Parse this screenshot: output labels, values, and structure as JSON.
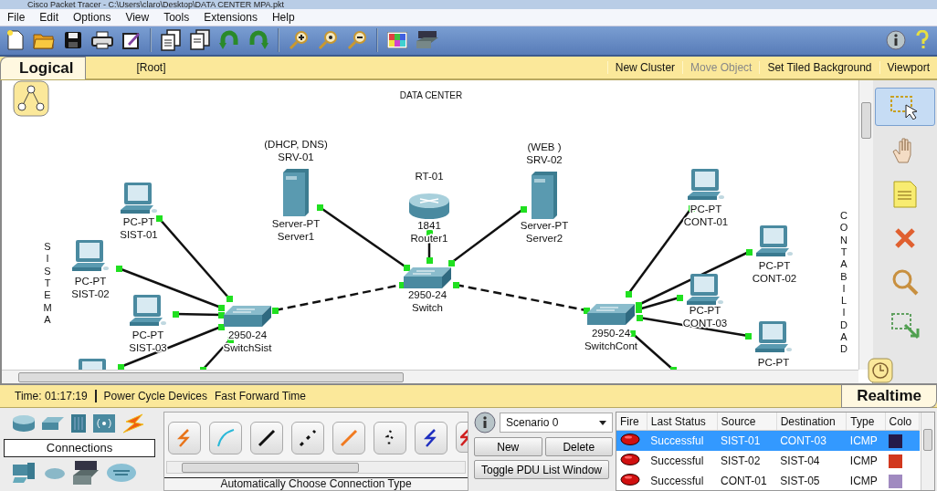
{
  "window": {
    "title": "Cisco Packet Tracer - C:\\Users\\claro\\Desktop\\DATA CENTER MPA.pkt"
  },
  "menu": [
    "File",
    "Edit",
    "Options",
    "View",
    "Tools",
    "Extensions",
    "Help"
  ],
  "workspace_bar": {
    "mode": "Logical",
    "path": "[Root]",
    "actions": [
      {
        "label": "New Cluster",
        "disabled": false
      },
      {
        "label": "Move Object",
        "disabled": true
      },
      {
        "label": "Set Tiled Background",
        "disabled": false
      },
      {
        "label": "Viewport",
        "disabled": false
      }
    ]
  },
  "canvas": {
    "title": "DATA CENTER",
    "areas": [
      "SISTEMA",
      "CONTABILIDAD"
    ],
    "devices": [
      {
        "kind": "pc",
        "model": "PC-PT",
        "name": "SIST-02"
      },
      {
        "kind": "pc"
      },
      {
        "kind": "pc",
        "model": "PC-PT",
        "name": "SIST-01"
      },
      {
        "kind": "pc",
        "model": "PC-PT",
        "name": "SIST-03"
      },
      {
        "kind": "switch",
        "model": "2950-24",
        "name": "SwitchSist"
      },
      {
        "kind": "server",
        "note": "(DHCP, DNS)",
        "hostname": "SRV-01",
        "model": "Server-PT",
        "name": "Server1"
      },
      {
        "kind": "router",
        "hostname": "RT-01",
        "model": "1841",
        "name": "Router1"
      },
      {
        "kind": "switch",
        "model": "2950-24",
        "name": "Switch"
      },
      {
        "kind": "server",
        "note": "(WEB )",
        "hostname": "SRV-02",
        "model": "Server-PT",
        "name": "Server2"
      },
      {
        "kind": "switch",
        "model": "2950-24",
        "name": "SwitchCont"
      },
      {
        "kind": "pc",
        "model": "PC-PT",
        "name": "CONT-01"
      },
      {
        "kind": "pc",
        "model": "PC-PT",
        "name": "CONT-03"
      },
      {
        "kind": "pc",
        "model": "PC-PT",
        "name": "CONT-02"
      },
      {
        "kind": "pc",
        "model": "PC-PT"
      }
    ]
  },
  "tools": [
    {
      "kind": "select",
      "selected": true
    },
    {
      "kind": "hand",
      "selected": false
    },
    {
      "kind": "note",
      "selected": false
    },
    {
      "kind": "delete",
      "selected": false
    },
    {
      "kind": "inspect",
      "selected": false
    },
    {
      "kind": "resize",
      "selected": false
    }
  ],
  "status_bar": {
    "time": "Time: 01:17:19",
    "actions": [
      "Power Cycle Devices",
      "Fast Forward Time"
    ],
    "mode": "Realtime"
  },
  "device_panel": {
    "category": "Connections",
    "hint": "Automatically Choose Connection Type"
  },
  "scenario": {
    "value": "Scenario 0",
    "buttons": [
      "New",
      "Delete"
    ],
    "toggle": "Toggle PDU List Window"
  },
  "pdu_table": {
    "columns": [
      "Fire",
      "Last Status",
      "Source",
      "Destination",
      "Type",
      "Colo"
    ],
    "rows": [
      {
        "last_status": "Successful",
        "source": "SIST-01",
        "destination": "CONT-03",
        "type": "ICMP",
        "color": "#241a4a",
        "selected": true
      },
      {
        "last_status": "Successful",
        "source": "SIST-02",
        "destination": "SIST-04",
        "type": "ICMP",
        "color": "#d2381e",
        "selected": false
      },
      {
        "last_status": "Successful",
        "source": "CONT-01",
        "destination": "SIST-05",
        "type": "ICMP",
        "color": "#a08ac0",
        "selected": false
      }
    ]
  }
}
